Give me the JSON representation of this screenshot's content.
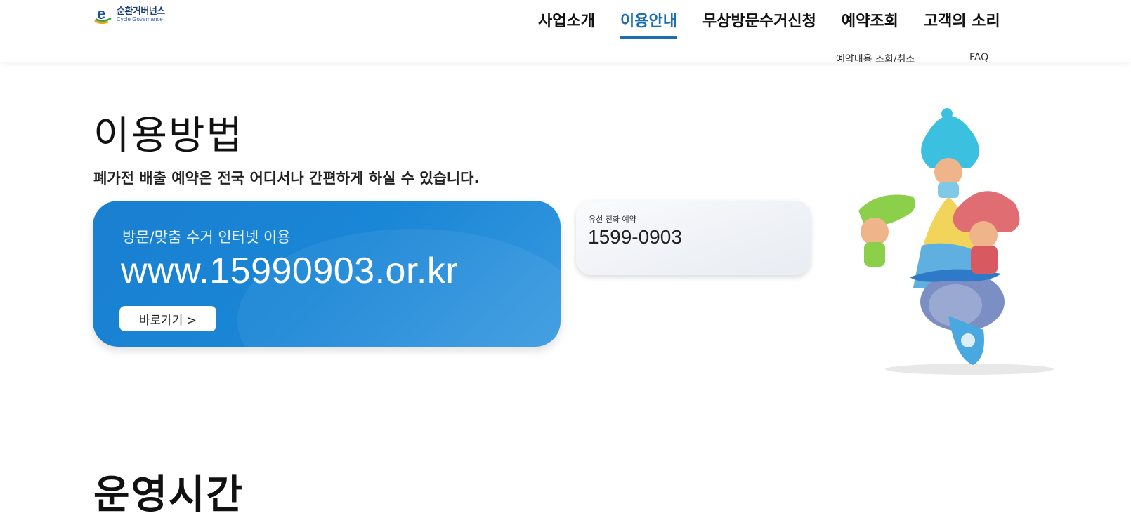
{
  "brand": {
    "title": "순환거버넌스",
    "subtitle": "Cycle Governance",
    "logo_icon": "e-logo-icon"
  },
  "nav": {
    "items": [
      {
        "label": "사업소개",
        "active": false
      },
      {
        "label": "이용안내",
        "active": true
      },
      {
        "label": "무상방문수거신청",
        "active": false
      },
      {
        "label": "예약조회",
        "active": false
      },
      {
        "label": "고객의 소리",
        "active": false
      }
    ],
    "submenu": {
      "reservation_lookup": "예약내용 조회/취소",
      "faq": "FAQ"
    }
  },
  "main": {
    "title": "이용방법",
    "description": "폐가전 배출 예약은 전국 어디서나 간편하게 하실 수 있습니다.",
    "internet_card": {
      "label": "방문/맞춤 수거 인터넷 이용",
      "url": "www.15990903.or.kr",
      "button": "바로가기 >"
    },
    "phone_card": {
      "label": "유선 전화 예약",
      "number": "1599-0903"
    },
    "next_section_title": "운영시간"
  },
  "colors": {
    "accent": "#1a6fb3",
    "card_blue": "#1a82d3",
    "card_gray": "#eef1f6"
  }
}
